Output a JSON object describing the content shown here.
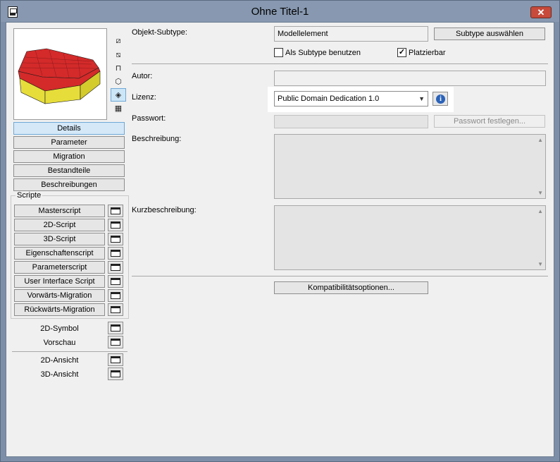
{
  "window": {
    "title": "Ohne Titel-1",
    "close_glyph": "✕"
  },
  "view_icons": [
    {
      "name": "plan-view-icon",
      "glyph": "⧄"
    },
    {
      "name": "section-view-icon",
      "glyph": "⧅"
    },
    {
      "name": "elevation-view-icon",
      "glyph": "⊓"
    },
    {
      "name": "axonometric-view-icon",
      "glyph": "⬡"
    },
    {
      "name": "3d-view-icon",
      "glyph": "◈"
    },
    {
      "name": "film-view-icon",
      "glyph": "▦"
    }
  ],
  "nav": {
    "details": "Details",
    "parameter": "Parameter",
    "migration": "Migration",
    "bestandteile": "Bestandteile",
    "beschreibungen": "Beschreibungen"
  },
  "scripts": {
    "group_title": "Scripte",
    "items": [
      "Masterscript",
      "2D-Script",
      "3D-Script",
      "Eigenschaftenscript",
      "Parameterscript",
      "User Interface Script",
      "Vorwärts-Migration",
      "Rückwärts-Migration"
    ]
  },
  "extras": {
    "symbol_2d": "2D-Symbol",
    "vorschau": "Vorschau",
    "ansicht_2d": "2D-Ansicht",
    "ansicht_3d": "3D-Ansicht"
  },
  "details": {
    "subtype_label": "Objekt-Subtype:",
    "subtype_value": "Modellelement",
    "subtype_button": "Subtype auswählen",
    "use_as_subtype_label": "Als Subtype benutzen",
    "use_as_subtype_checked": false,
    "placeable_label": "Platzierbar",
    "placeable_checked": true,
    "author_label": "Autor:",
    "author_value": "",
    "license_label": "Lizenz:",
    "license_value": "Public Domain Dedication 1.0",
    "password_label": "Passwort:",
    "password_button": "Passwort festlegen...",
    "description_label": "Beschreibung:",
    "short_description_label": "Kurzbeschreibung:",
    "compat_button": "Kompatibilitätsoptionen..."
  },
  "colors": {
    "model_roof": "#d42a2a",
    "model_wall": "#e6dd3a",
    "accent": "#6fa8d6"
  }
}
